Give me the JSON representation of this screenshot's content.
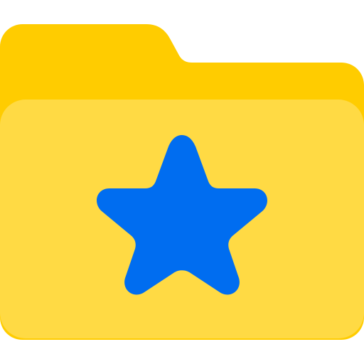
{
  "icon": {
    "name": "favorite-folder-icon",
    "colors": {
      "folder_back": "#FFCC00",
      "folder_front": "#FFDA44",
      "star": "#006DF0",
      "background": "#FFFFFF"
    }
  }
}
